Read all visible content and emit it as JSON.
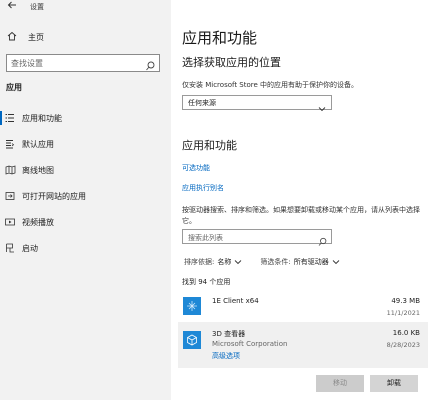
{
  "window": {
    "title": "设置"
  },
  "sidebar": {
    "home_label": "主页",
    "search_placeholder": "查找设置",
    "section_header": "应用",
    "items": [
      {
        "label": "应用和功能",
        "icon": "apps-list-icon",
        "active": true
      },
      {
        "label": "默认应用",
        "icon": "default-apps-icon"
      },
      {
        "label": "离线地图",
        "icon": "offline-maps-icon"
      },
      {
        "label": "可打开网站的应用",
        "icon": "apps-for-websites-icon"
      },
      {
        "label": "视频播放",
        "icon": "video-playback-icon"
      },
      {
        "label": "启动",
        "icon": "startup-icon"
      }
    ]
  },
  "main": {
    "title": "应用和功能",
    "install_section": {
      "heading": "选择获取应用的位置",
      "description": "仅安装 Microsoft Store 中的应用有助于保护你的设备。",
      "dropdown_value": "任何来源"
    },
    "apps_section": {
      "heading": "应用和功能",
      "link_optional": "可选功能",
      "link_aliases": "应用执行别名",
      "description": "按驱动器搜索、排序和筛选。如果想要卸载或移动某个应用，请从列表中选择它。",
      "search_placeholder": "搜索此列表",
      "sort_label": "排序依据:",
      "sort_value": "名称",
      "filter_label": "筛选条件:",
      "filter_value": "所有驱动器",
      "count_text": "找到 94 个应用"
    },
    "apps": [
      {
        "name": "1E Client x64",
        "publisher": "",
        "size": "49.3 MB",
        "date": "11/1/2021"
      },
      {
        "name": "3D 查看器",
        "publisher": "Microsoft Corporation",
        "size": "16.0 KB",
        "date": "8/28/2023",
        "advanced": "高级选项"
      }
    ],
    "buttons": {
      "move": "移动",
      "uninstall": "卸载"
    }
  },
  "colors": {
    "accent": "#0067c0",
    "sidebar_bg": "#f2f2f2",
    "app_icon": "#1e88d6"
  }
}
